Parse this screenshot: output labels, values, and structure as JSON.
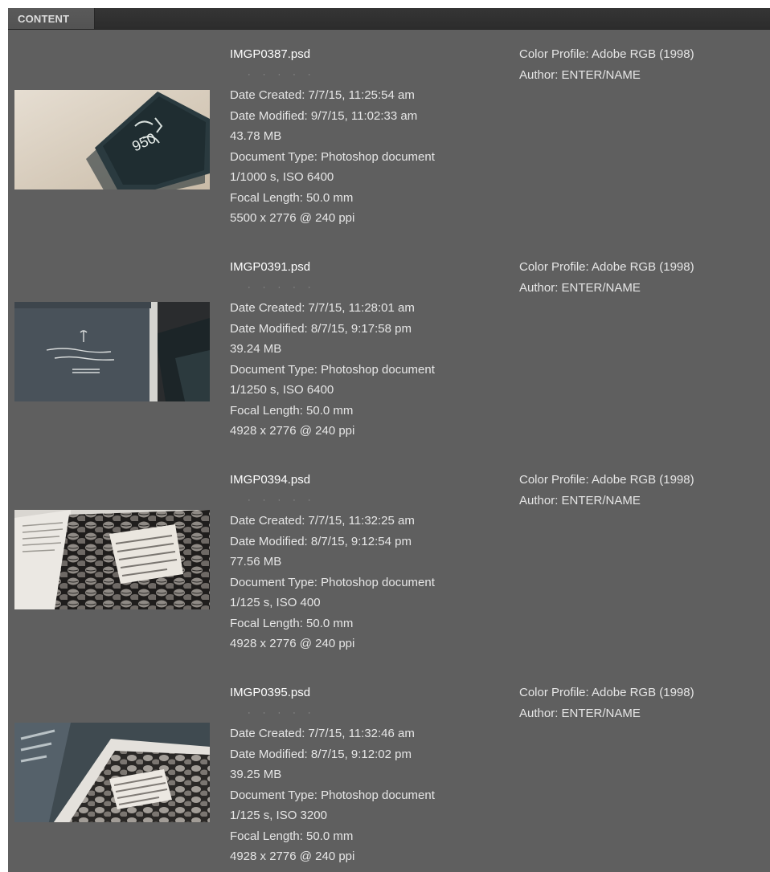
{
  "panel": {
    "tab_label": "CONTENT"
  },
  "items": [
    {
      "filename": "IMGP0387.psd",
      "rating": "· · · · ·",
      "date_created": "Date Created: 7/7/15, 11:25:54 am",
      "date_modified": "Date Modified: 9/7/15, 11:02:33 am",
      "size": "43.78 MB",
      "doc_type": "Document Type: Photoshop document",
      "exposure": "1/1000 s, ISO 6400",
      "focal_length": "Focal Length: 50.0 mm",
      "dimensions": "5500 x 2776 @ 240 ppi",
      "color_profile": "Color Profile: Adobe RGB (1998)",
      "author": "Author: ENTER/NAME"
    },
    {
      "filename": "IMGP0391.psd",
      "rating": "· · · · ·",
      "date_created": "Date Created: 7/7/15, 11:28:01 am",
      "date_modified": "Date Modified: 8/7/15, 9:17:58 pm",
      "size": "39.24 MB",
      "doc_type": "Document Type: Photoshop document",
      "exposure": "1/1250 s, ISO 6400",
      "focal_length": "Focal Length: 50.0 mm",
      "dimensions": "4928 x 2776 @ 240 ppi",
      "color_profile": "Color Profile: Adobe RGB (1998)",
      "author": "Author: ENTER/NAME"
    },
    {
      "filename": "IMGP0394.psd",
      "rating": "· · · · ·",
      "date_created": "Date Created: 7/7/15, 11:32:25 am",
      "date_modified": "Date Modified: 8/7/15, 9:12:54 pm",
      "size": "77.56 MB",
      "doc_type": "Document Type: Photoshop document",
      "exposure": "1/125 s, ISO 400",
      "focal_length": "Focal Length: 50.0 mm",
      "dimensions": "4928 x 2776 @ 240 ppi",
      "color_profile": "Color Profile: Adobe RGB (1998)",
      "author": "Author: ENTER/NAME"
    },
    {
      "filename": "IMGP0395.psd",
      "rating": "· · · · ·",
      "date_created": "Date Created: 7/7/15, 11:32:46 am",
      "date_modified": "Date Modified: 8/7/15, 9:12:02 pm",
      "size": "39.25 MB",
      "doc_type": "Document Type: Photoshop document",
      "exposure": "1/125 s, ISO 3200",
      "focal_length": "Focal Length: 50.0 mm",
      "dimensions": "4928 x 2776 @ 240 ppi",
      "color_profile": "Color Profile: Adobe RGB (1998)",
      "author": "Author: ENTER/NAME"
    }
  ]
}
